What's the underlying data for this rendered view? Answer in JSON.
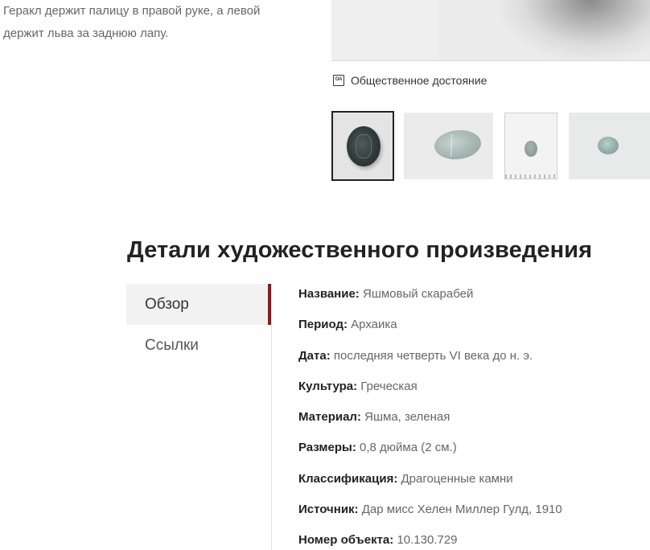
{
  "description": {
    "line1": "Геракл держит палицу в правой руке, а левой",
    "line2": "держит льва за заднюю лапу."
  },
  "license": {
    "icon": "oa-icon",
    "icon_text": "OA",
    "label": "Общественное достояние"
  },
  "thumbnails": [
    {
      "icon": "scarab-seal-impression",
      "selected": true
    },
    {
      "icon": "scarab-side-view",
      "selected": false
    },
    {
      "icon": "scarab-with-ruler",
      "selected": false
    },
    {
      "icon": "scarab-top-view",
      "selected": false
    }
  ],
  "section": {
    "title": "Детали художественного произведения"
  },
  "tabs": [
    {
      "label": "Обзор",
      "active": true
    },
    {
      "label": "Ссылки",
      "active": false
    }
  ],
  "details": [
    {
      "label": "Название:",
      "value": "Яшмовый скарабей"
    },
    {
      "label": "Период:",
      "value": "Архаика"
    },
    {
      "label": "Дата:",
      "value": "последняя четверть VI века до н. э."
    },
    {
      "label": "Культура:",
      "value": "Греческая"
    },
    {
      "label": "Материал:",
      "value": "Яшма, зеленая"
    },
    {
      "label": "Размеры:",
      "value": "0,8 дюйма (2 см.)"
    },
    {
      "label": "Классификация:",
      "value": "Драгоценные камни"
    },
    {
      "label": "Источник:",
      "value": "Дар мисс Хелен Миллер Гулд, 1910"
    },
    {
      "label": "Номер объекта:",
      "value": "10.130.729"
    }
  ],
  "colors": {
    "accent": "#8b1c1c",
    "text": "#222222",
    "muted": "#666666"
  }
}
